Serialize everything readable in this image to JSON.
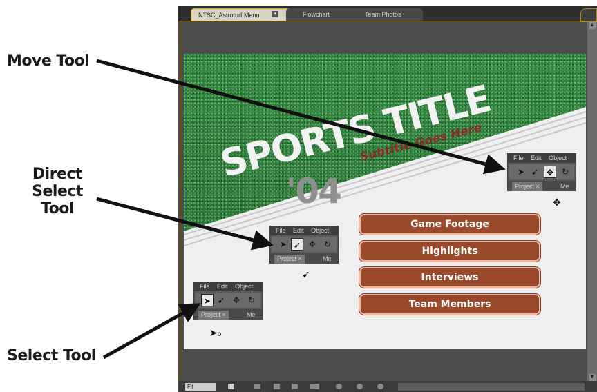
{
  "callouts": {
    "move_tool": "Move Tool",
    "direct_select_line1": "Direct Select",
    "direct_select_line2": "Tool",
    "select_tool": "Select Tool"
  },
  "tabs": [
    {
      "label": "NTSC_Astroturf Menu"
    },
    {
      "label": "Flowchart"
    },
    {
      "label": "Team Photos"
    }
  ],
  "canvas": {
    "title": "SPORTS TITLE",
    "subtitle": "Subtitle Goes Here",
    "year": "'04",
    "buttons": [
      "Game Footage",
      "Highlights",
      "Interviews",
      "Team Members"
    ],
    "colors": {
      "turf": "#2e7d39",
      "button": "#9a4a2a",
      "subtitle": "#8b2a24"
    }
  },
  "tool_panel": {
    "menu": [
      "File",
      "Edit",
      "Object"
    ],
    "tab_project": "Project",
    "tab_close": "×",
    "tab_more": "Me",
    "tools": [
      "select-icon",
      "direct-select-icon",
      "move-icon",
      "rotate-icon"
    ]
  },
  "statusbar": {
    "zoom": "Fit"
  }
}
